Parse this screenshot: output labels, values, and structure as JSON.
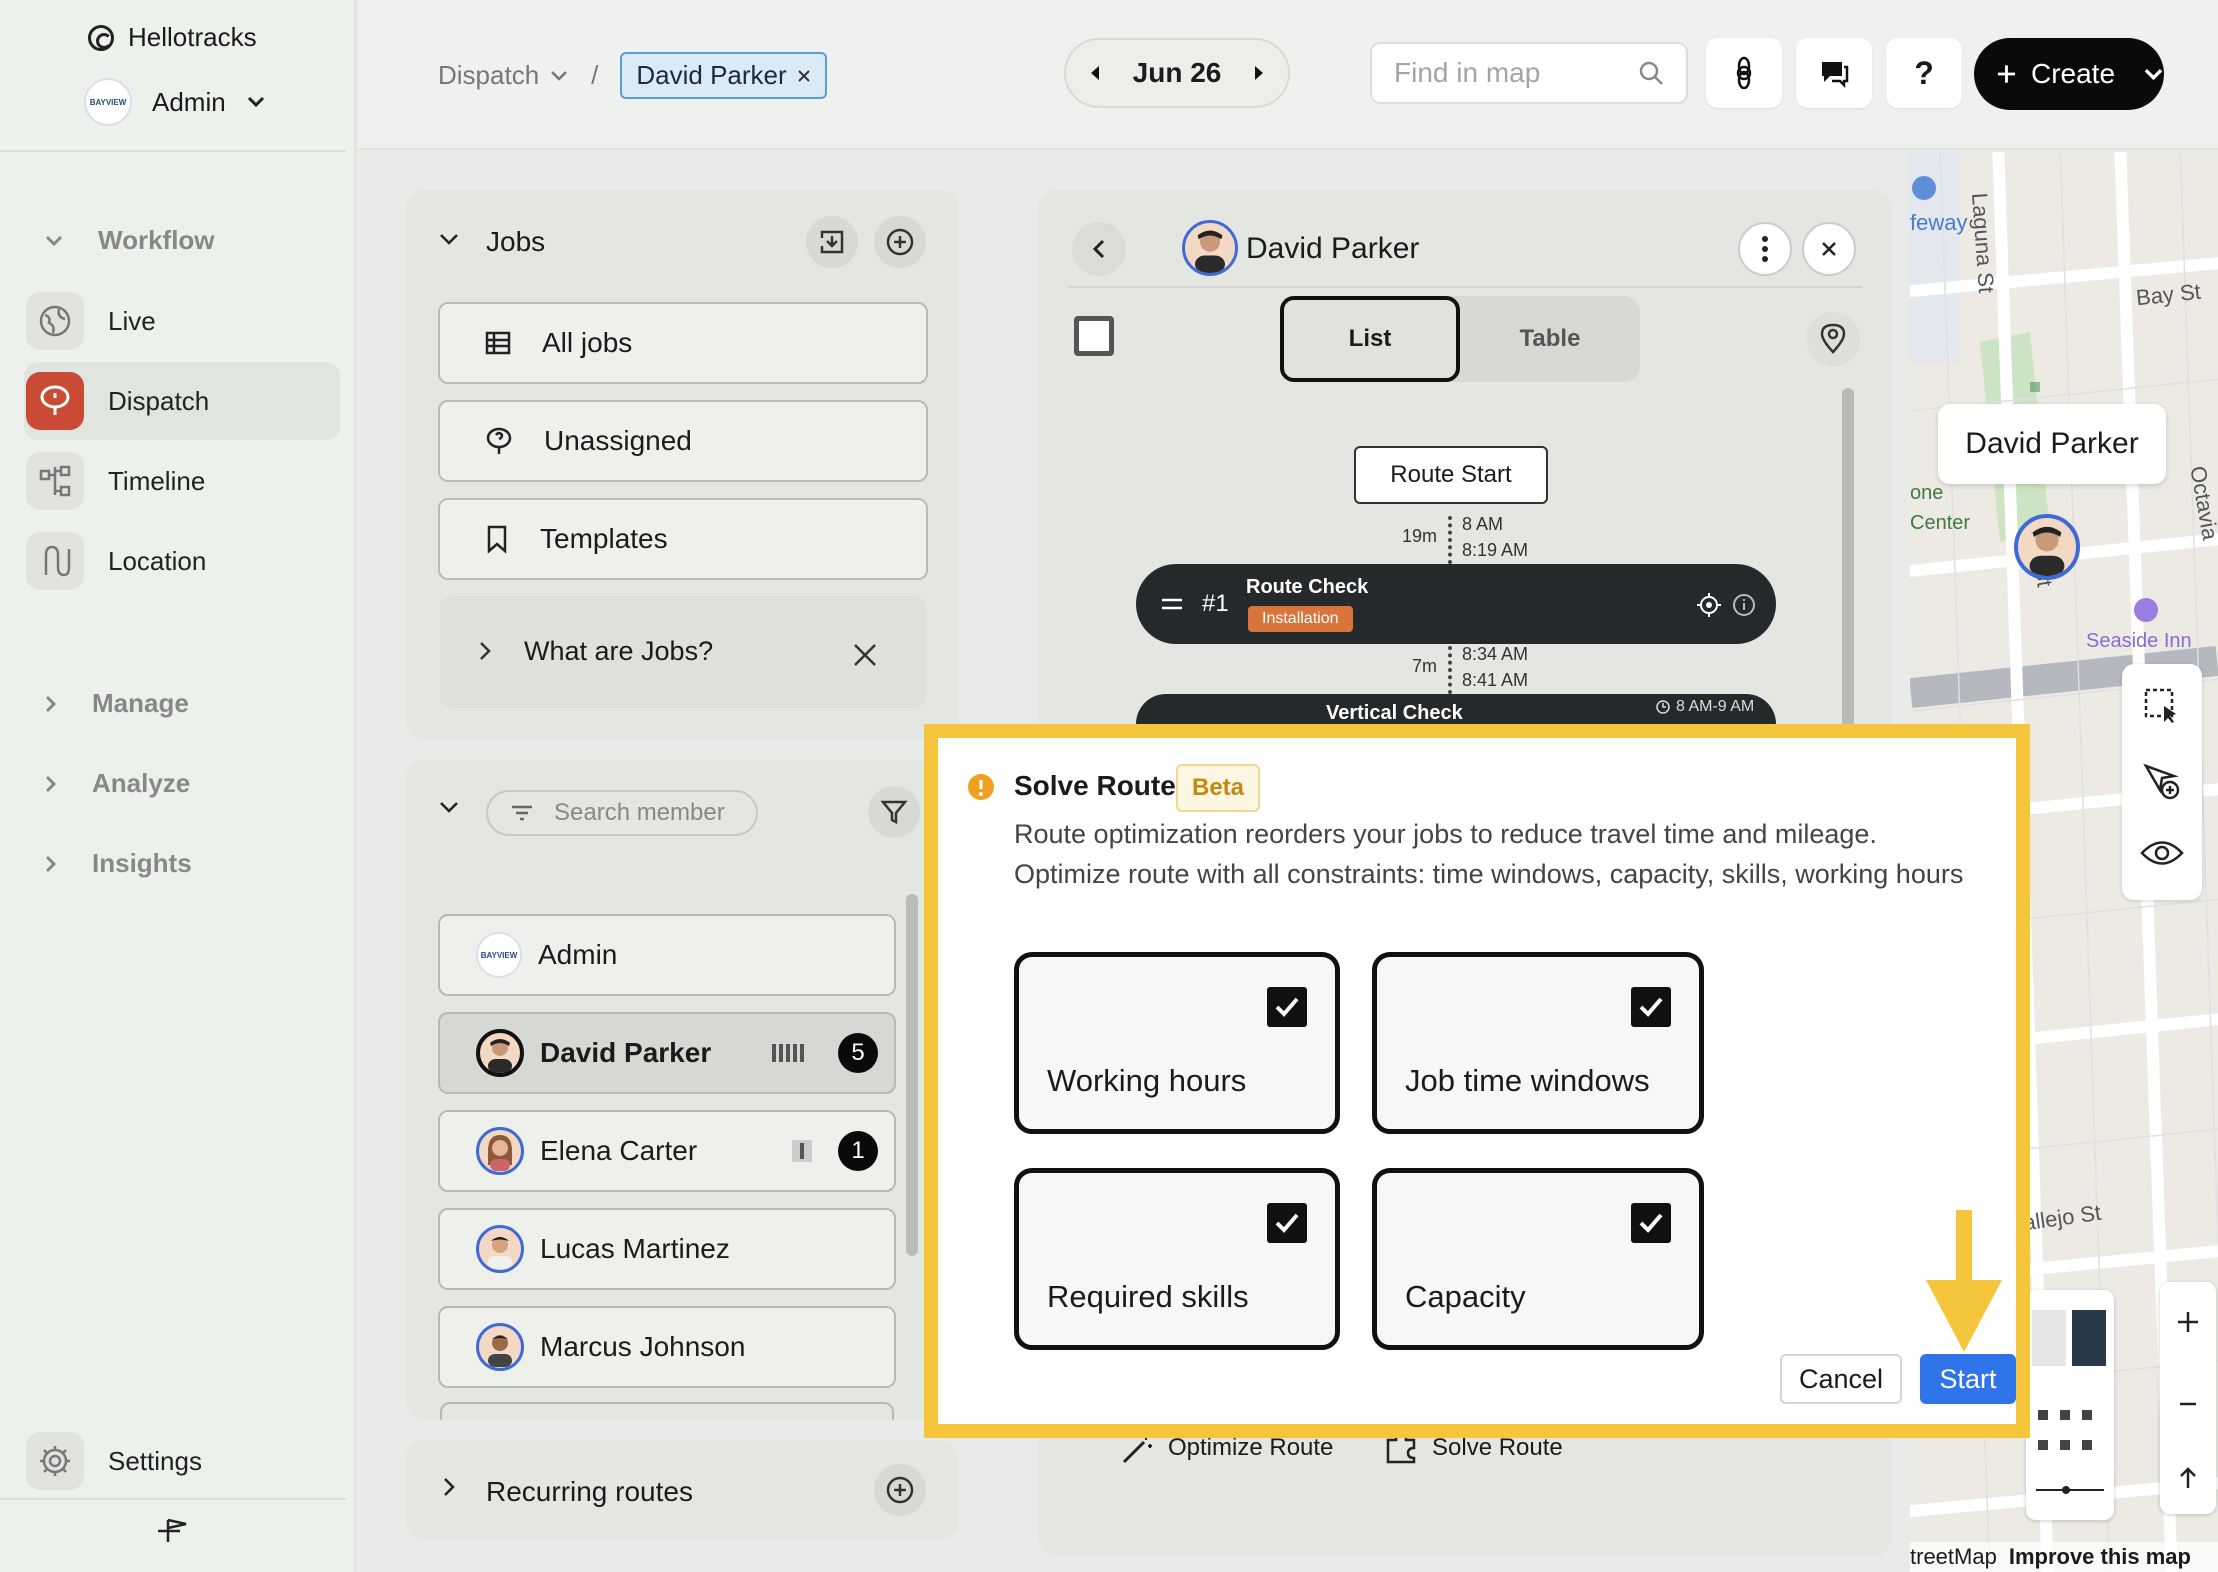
{
  "app": {
    "name": "Hellotracks",
    "org_role": "Admin",
    "org_logo_text": "BAYVIEW"
  },
  "sidebar": {
    "groups": [
      {
        "label": "Workflow"
      },
      {
        "label": "Manage"
      },
      {
        "label": "Analyze"
      },
      {
        "label": "Insights"
      }
    ],
    "items": [
      {
        "label": "Live",
        "icon": "globe-icon"
      },
      {
        "label": "Dispatch",
        "icon": "dispatch-pin-icon",
        "active": true
      },
      {
        "label": "Timeline",
        "icon": "timeline-icon"
      },
      {
        "label": "Location",
        "icon": "route-path-icon"
      }
    ],
    "settings_label": "Settings"
  },
  "topbar": {
    "breadcrumb_root": "Dispatch",
    "breadcrumb_chip": "David Parker",
    "date": "Jun 26",
    "search_placeholder": "Find in map",
    "help_label": "?",
    "create_label": "Create"
  },
  "jobs": {
    "title": "Jobs",
    "items": [
      {
        "label": "All jobs"
      },
      {
        "label": "Unassigned"
      },
      {
        "label": "Templates"
      }
    ],
    "help_row": "What are Jobs?"
  },
  "members": {
    "search_placeholder": "Search member",
    "list": [
      {
        "name": "Admin",
        "count": ""
      },
      {
        "name": "David Parker",
        "count": "5",
        "selected": true
      },
      {
        "name": "Elena Carter",
        "count": "1"
      },
      {
        "name": "Lucas Martinez",
        "count": ""
      },
      {
        "name": "Marcus Johnson",
        "count": ""
      }
    ]
  },
  "recurring": {
    "label": "Recurring routes"
  },
  "route": {
    "worker": "David Parker",
    "tabs": [
      "List",
      "Table"
    ],
    "active_tab": "List",
    "route_start": "Route Start",
    "leg1": {
      "duration": "19m",
      "arrive": "8 AM",
      "depart": "8:19 AM"
    },
    "job1": {
      "number": "#1",
      "title": "Route Check",
      "tag": "Installation"
    },
    "leg2": {
      "duration": "7m",
      "arrive": "8:34 AM",
      "depart": "8:41 AM"
    },
    "job2": {
      "title": "Vertical Check",
      "window": "8 AM-9 AM"
    },
    "footer": {
      "optimize": "Optimize Route",
      "solve": "Solve Route"
    }
  },
  "map": {
    "labels": [
      "Laguna St",
      "Bay St",
      "Octavia",
      "feway",
      "one",
      "Center",
      "Seaside Inn",
      "Vallejo St",
      "St",
      "B"
    ],
    "pin_label": "David Parker",
    "attribution": "treetMap",
    "improve": "Improve this map"
  },
  "dialog": {
    "title": "Solve Route",
    "badge": "Beta",
    "line1": "Route optimization reorders your jobs to reduce travel time and mileage.",
    "line2": "Optimize route with all constraints: time windows, capacity, skills, working hours",
    "options": [
      {
        "label": "Working hours",
        "checked": true
      },
      {
        "label": "Job time windows",
        "checked": true
      },
      {
        "label": "Required skills",
        "checked": true
      },
      {
        "label": "Capacity",
        "checked": true
      }
    ],
    "cancel_label": "Cancel",
    "start_label": "Start"
  },
  "colors": {
    "accent_blue": "#2f74e8",
    "highlight_yellow": "#f5c63c",
    "dispatch_red": "#c94a35",
    "tag_orange": "#d9743a"
  }
}
